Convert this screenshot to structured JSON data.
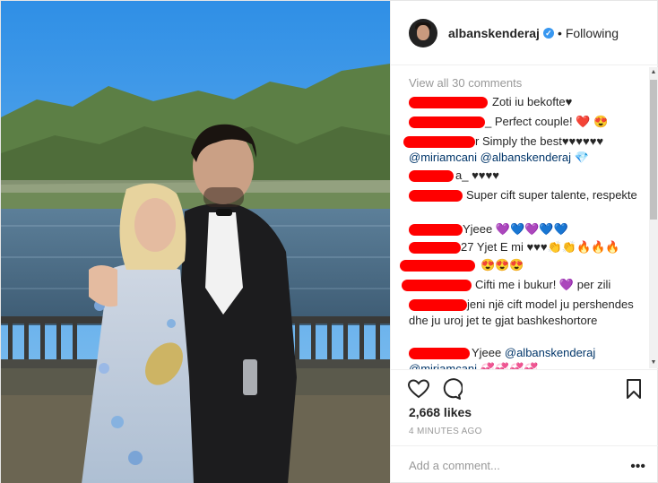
{
  "header": {
    "username": "albanskenderaj",
    "verified_glyph": "✓",
    "separator": "•",
    "follow_label": "Following"
  },
  "comments": {
    "view_all": "View all 30 comments",
    "items": [
      {
        "author": "",
        "text": "Zoti iu bekofte♥"
      },
      {
        "author": "",
        "text": "_ Perfect couple! ❤️ 😍"
      },
      {
        "author": "",
        "text": "r Simply the best♥♥♥♥♥♥",
        "mention1": "@miriamcani",
        "mention2": "@albanskenderaj",
        "tail": "💎"
      },
      {
        "author": "",
        "text": "a_ ♥♥♥♥"
      },
      {
        "author": "",
        "text": "Super cift super talente, respekte"
      },
      {
        "author": "",
        "text": "Yjeee 💜💙💜💙💙"
      },
      {
        "author": "",
        "text": "27 Yjet E mi ♥♥♥👏👏🔥🔥🔥"
      },
      {
        "author": "",
        "text": "😍😍😍"
      },
      {
        "author": "",
        "text": "Cifti me i bukur! 💜 per zili"
      },
      {
        "author": "",
        "text": "jeni një cift model ju pershendes dhe ju uroj jet te gjat bashkeshortore"
      },
      {
        "author": "",
        "text": "Yjeee",
        "mention1": "@albanskenderaj",
        "mention2": "@miriamcani",
        "tail": "💞💞💞💞"
      }
    ]
  },
  "actions": {
    "like_icon": "heart-icon",
    "comment_icon": "comment-icon",
    "save_icon": "bookmark-icon"
  },
  "likes": "2,668 likes",
  "timestamp": "4 MINUTES AGO",
  "add_comment": {
    "placeholder": "Add a comment...",
    "more": "•••"
  }
}
